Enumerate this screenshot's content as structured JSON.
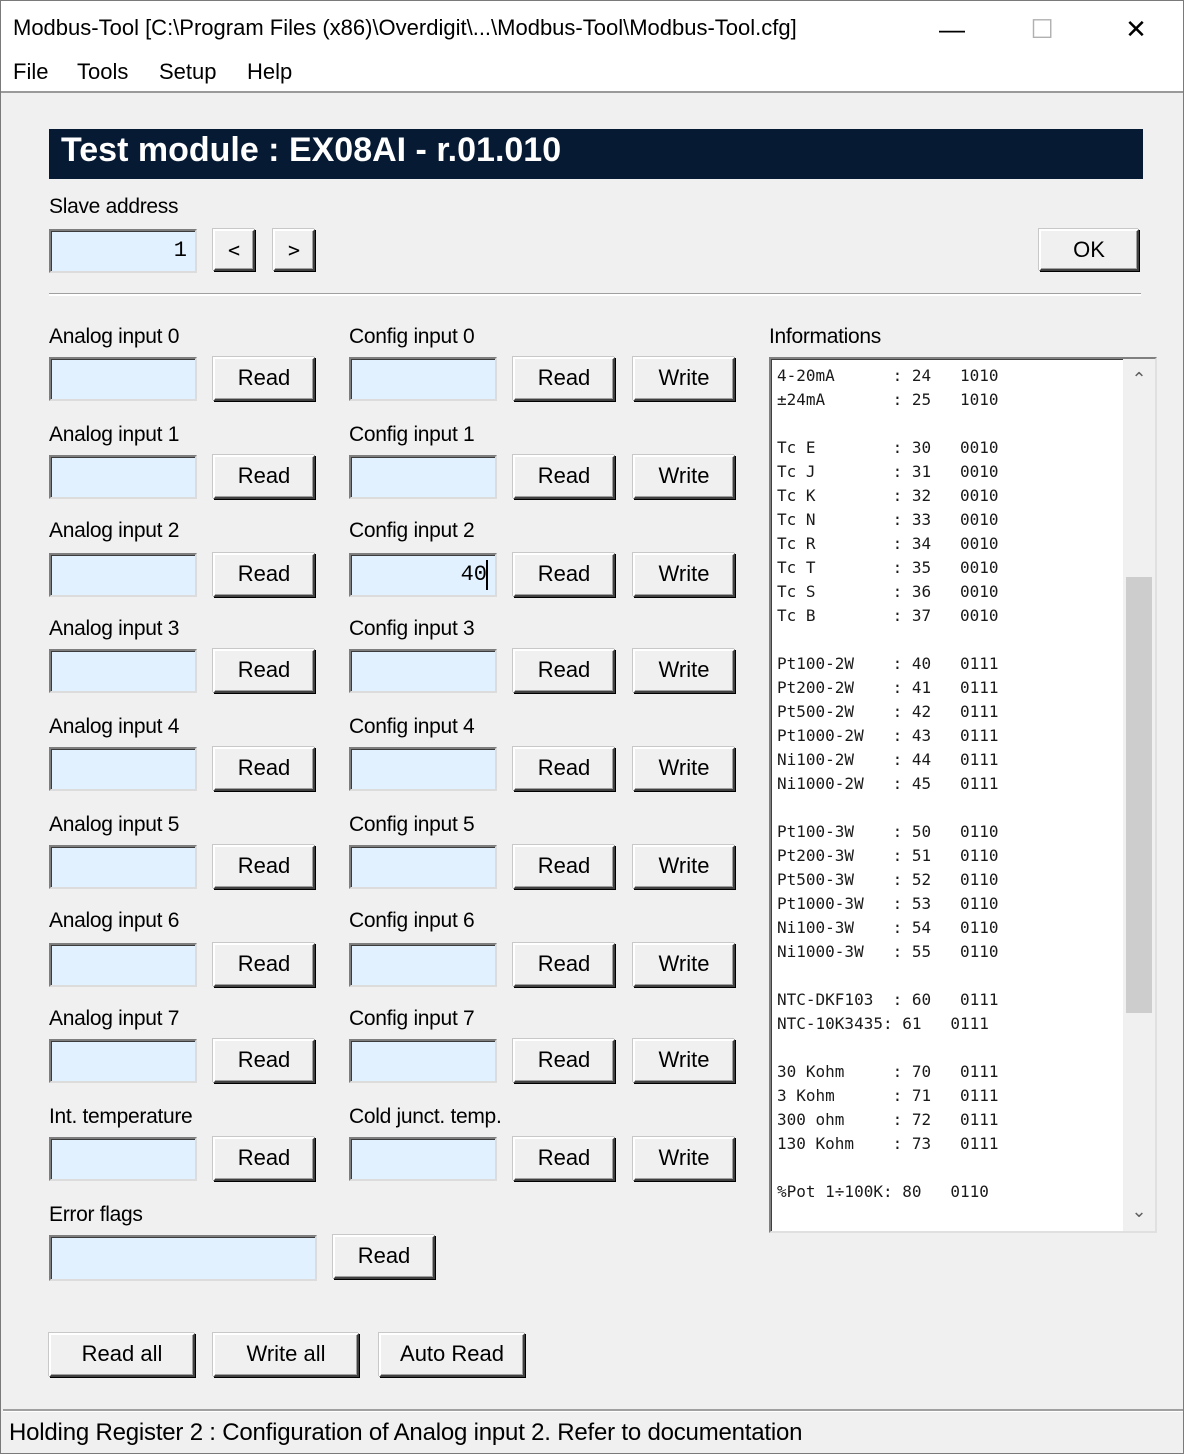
{
  "window": {
    "title": "Modbus-Tool [C:\\Program Files (x86)\\Overdigit\\...\\Modbus-Tool\\Modbus-Tool.cfg]",
    "minimize_glyph": "—",
    "maximize_glyph": "☐",
    "close_glyph": "✕"
  },
  "menu": {
    "file": "File",
    "tools": "Tools",
    "setup": "Setup",
    "help": "Help"
  },
  "header": {
    "title": "Test module : EX08AI - r.01.010"
  },
  "slave": {
    "label": "Slave address",
    "value": "1",
    "prev": "<",
    "next": ">",
    "ok": "OK"
  },
  "analog_inputs": [
    {
      "label": "Analog input 0",
      "value": "",
      "read": "Read"
    },
    {
      "label": "Analog input 1",
      "value": "",
      "read": "Read"
    },
    {
      "label": "Analog input 2",
      "value": "",
      "read": "Read"
    },
    {
      "label": "Analog input 3",
      "value": "",
      "read": "Read"
    },
    {
      "label": "Analog input 4",
      "value": "",
      "read": "Read"
    },
    {
      "label": "Analog input 5",
      "value": "",
      "read": "Read"
    },
    {
      "label": "Analog input 6",
      "value": "",
      "read": "Read"
    },
    {
      "label": "Analog input 7",
      "value": "",
      "read": "Read"
    }
  ],
  "config_inputs": [
    {
      "label": "Config input 0",
      "value": "",
      "read": "Read",
      "write": "Write"
    },
    {
      "label": "Config input 1",
      "value": "",
      "read": "Read",
      "write": "Write"
    },
    {
      "label": "Config input 2",
      "value": "40",
      "read": "Read",
      "write": "Write"
    },
    {
      "label": "Config input 3",
      "value": "",
      "read": "Read",
      "write": "Write"
    },
    {
      "label": "Config input 4",
      "value": "",
      "read": "Read",
      "write": "Write"
    },
    {
      "label": "Config input 5",
      "value": "",
      "read": "Read",
      "write": "Write"
    },
    {
      "label": "Config input 6",
      "value": "",
      "read": "Read",
      "write": "Write"
    },
    {
      "label": "Config input 7",
      "value": "",
      "read": "Read",
      "write": "Write"
    }
  ],
  "int_temp": {
    "label": "Int. temperature",
    "value": "",
    "read": "Read"
  },
  "cold_junct": {
    "label": "Cold junct. temp.",
    "value": "",
    "read": "Read",
    "write": "Write"
  },
  "error_flags": {
    "label": "Error flags",
    "value": "",
    "read": "Read"
  },
  "bottom_buttons": {
    "read_all": "Read all",
    "write_all": "Write all",
    "auto_read": "Auto Read"
  },
  "informations": {
    "label": "Informations",
    "lines": [
      "4-20mA      : 24   1010",
      "±24mA       : 25   1010",
      "",
      "Tc E        : 30   0010",
      "Tc J        : 31   0010",
      "Tc K        : 32   0010",
      "Tc N        : 33   0010",
      "Tc R        : 34   0010",
      "Tc T        : 35   0010",
      "Tc S        : 36   0010",
      "Tc B        : 37   0010",
      "",
      "Pt100-2W    : 40   0111",
      "Pt200-2W    : 41   0111",
      "Pt500-2W    : 42   0111",
      "Pt1000-2W   : 43   0111",
      "Ni100-2W    : 44   0111",
      "Ni1000-2W   : 45   0111",
      "",
      "Pt100-3W    : 50   0110",
      "Pt200-3W    : 51   0110",
      "Pt500-3W    : 52   0110",
      "Pt1000-3W   : 53   0110",
      "Ni100-3W    : 54   0110",
      "Ni1000-3W   : 55   0110",
      "",
      "NTC-DKF103  : 60   0111",
      "NTC-10K3435: 61   0111",
      "",
      "30 Kohm     : 70   0111",
      "3 Kohm      : 71   0111",
      "300 ohm     : 72   0111",
      "130 Kohm    : 73   0111",
      "",
      "%Pot 1÷100K: 80   0110"
    ],
    "scroll_up": "⌃",
    "scroll_down": "⌄",
    "scroll_position": 0.45
  },
  "status": {
    "text": "Holding Register 2 : Configuration of Analog input 2. Refer to documentation"
  },
  "colors": {
    "header_bg": "#071a33",
    "field_bg": "#e1f1ff",
    "window_bg": "#f0f0f0"
  }
}
